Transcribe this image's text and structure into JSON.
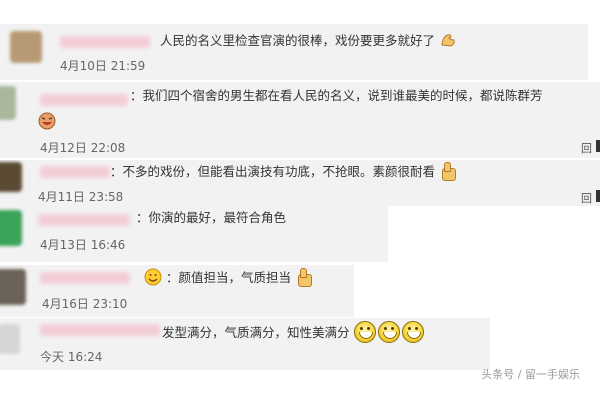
{
  "comments": [
    {
      "text": "人民的名义里检查官演的很棒，戏份要更多就好了",
      "time": "4月10日 21:59"
    },
    {
      "text": "：我们四个宿舍的男生都在看人民的名义，说到谁最美的时候，都说陈群芳",
      "time": "4月12日 22:08",
      "reply": "回"
    },
    {
      "text": "：不多的戏份，但能看出演技有功底，不抢眼。素颜很耐看",
      "time": "4月11日 23:58",
      "reply": "回"
    },
    {
      "text": "：你演的最好，最符合角色",
      "time": "4月13日 16:46"
    },
    {
      "text": "：颜值担当，气质担当",
      "time": "4月16日 23:10"
    },
    {
      "text": "发型满分，气质满分，知性美满分",
      "time": "今天 16:24"
    }
  ],
  "watermark": "头条号 / 留一手娱乐",
  "icons": [
    "flexed-biceps-icon",
    "thumbs-up-icon",
    "laughing-face-icon",
    "reply-icon"
  ],
  "colors": {
    "background": "#ffffff",
    "comment_bg": "#f2f2f2",
    "text": "#333333",
    "name_blur": "#f3c6d2"
  }
}
